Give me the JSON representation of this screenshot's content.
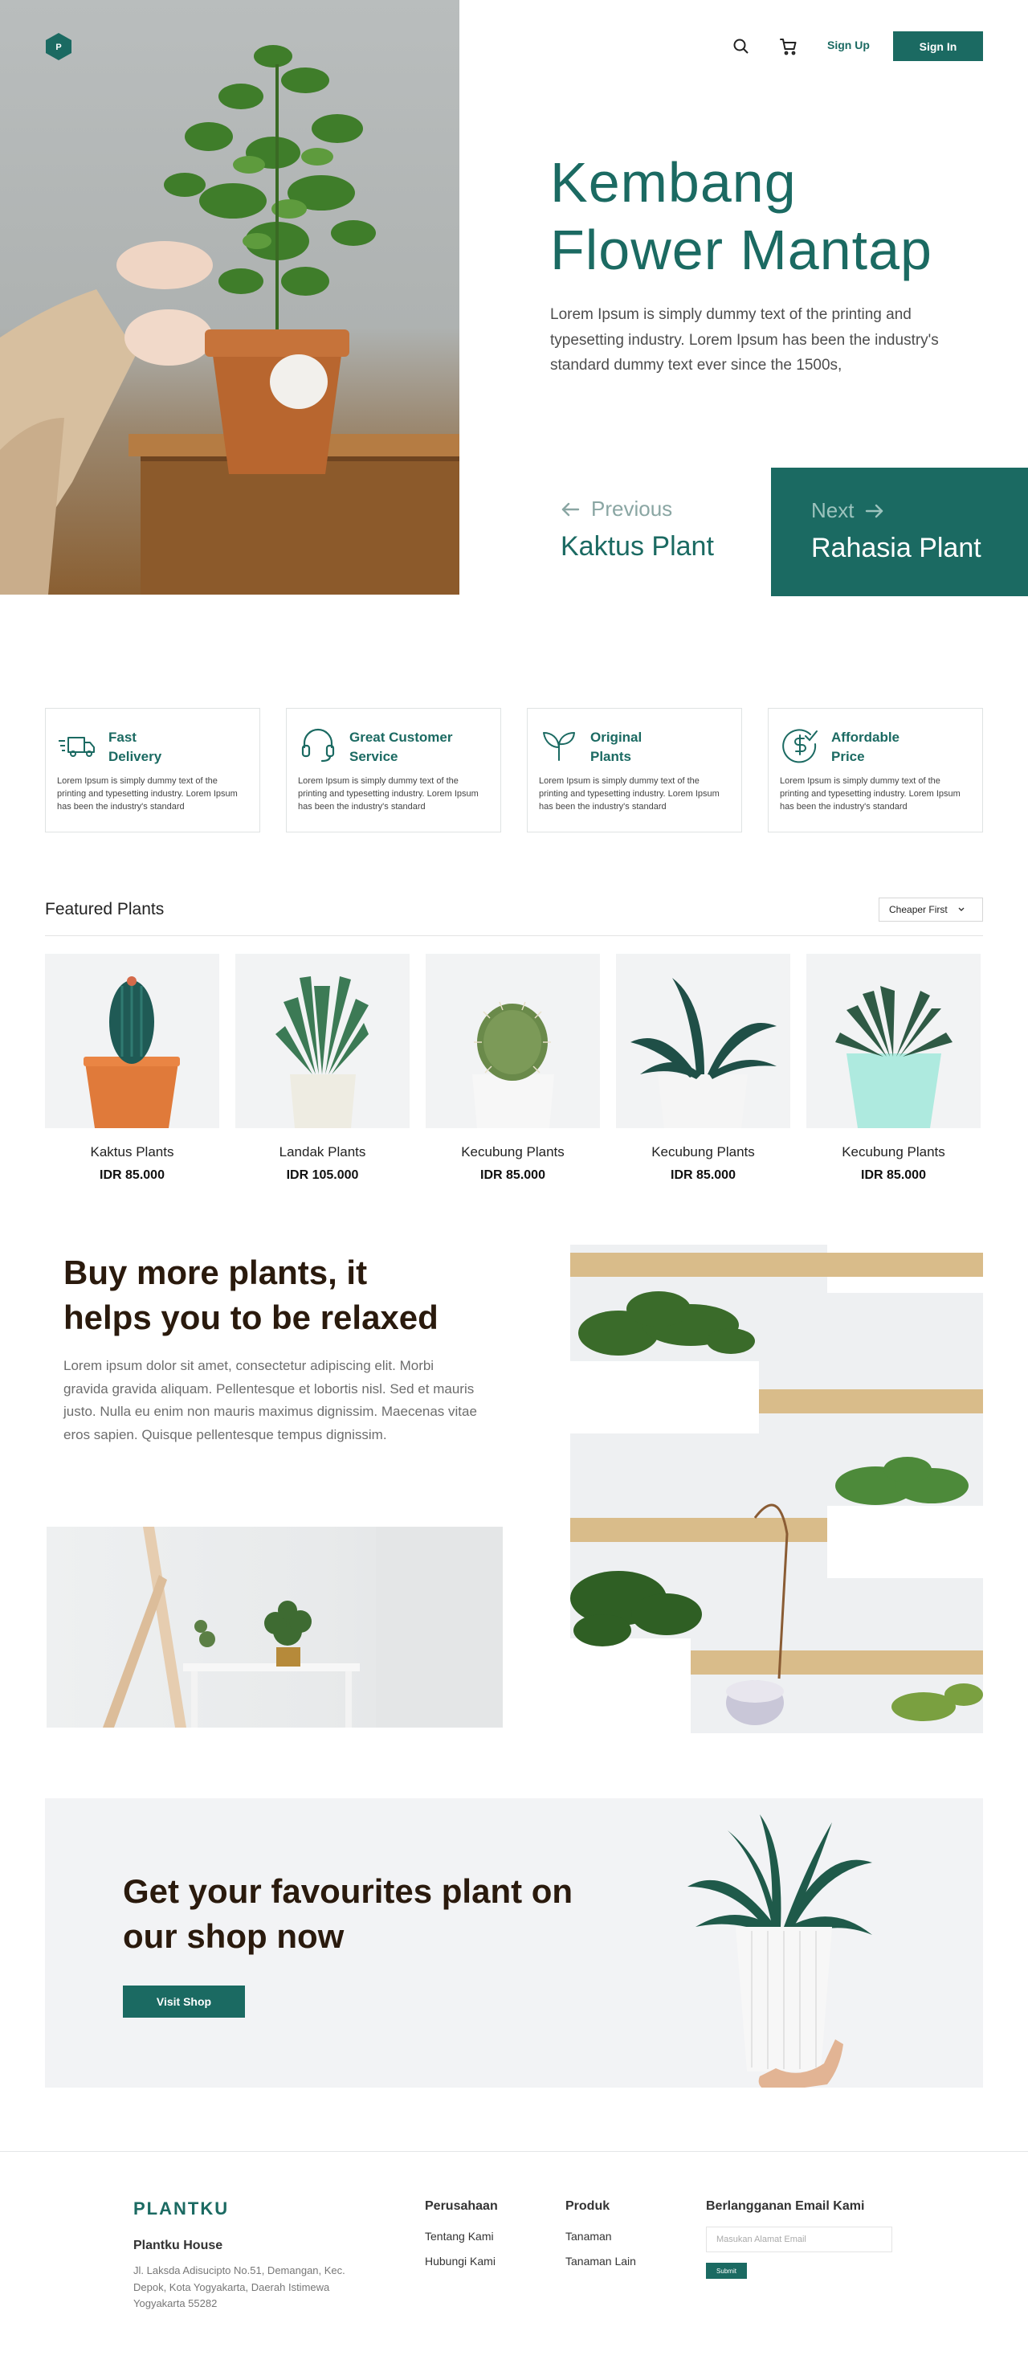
{
  "brand": {
    "logo_letter": "P",
    "accent": "#1b6a62"
  },
  "nav": {
    "signup": "Sign Up",
    "signin": "Sign In"
  },
  "hero": {
    "title_line1": "Kembang",
    "title_line2": "Flower Mantap",
    "description": "Lorem Ipsum is simply dummy text of the printing and typesetting industry. Lorem Ipsum has been the industry's standard dummy text ever since the 1500s,",
    "prev_label": "Previous",
    "prev_name": "Kaktus Plant",
    "next_label": "Next",
    "next_name": "Rahasia Plant"
  },
  "features": [
    {
      "icon": "truck-icon",
      "title_line1": "Fast",
      "title_line2": "Delivery",
      "desc": "Lorem Ipsum is simply dummy text of the printing and typesetting industry. Lorem Ipsum has been the industry's standard"
    },
    {
      "icon": "headset-icon",
      "title_line1": "Great Customer",
      "title_line2": "Service",
      "desc": "Lorem Ipsum is simply dummy text of the printing and typesetting industry. Lorem Ipsum has been the industry's standard"
    },
    {
      "icon": "sprout-icon",
      "title_line1": "Original",
      "title_line2": "Plants",
      "desc": "Lorem Ipsum is simply dummy text of the printing and typesetting industry. Lorem Ipsum has been the industry's standard"
    },
    {
      "icon": "dollar-badge-icon",
      "title_line1": "Affordable",
      "title_line2": "Price",
      "desc": "Lorem Ipsum is simply dummy text of the printing and typesetting industry. Lorem Ipsum has been the industry's standard"
    }
  ],
  "featured": {
    "title": "Featured Plants",
    "sort": "Cheaper First",
    "products": [
      {
        "name": "Kaktus Plants",
        "price": "IDR 85.000"
      },
      {
        "name": "Landak Plants",
        "price": "IDR 105.000"
      },
      {
        "name": "Kecubung Plants",
        "price": "IDR 85.000"
      },
      {
        "name": "Kecubung Plants",
        "price": "IDR 85.000"
      },
      {
        "name": "Kecubung Plants",
        "price": "IDR 85.000"
      }
    ]
  },
  "relax": {
    "title_line1": "Buy more plants, it",
    "title_line2": "helps you to be relaxed",
    "description": "Lorem ipsum dolor sit amet, consectetur adipiscing elit. Morbi gravida gravida aliquam. Pellentesque et lobortis nisl. Sed et mauris justo. Nulla eu enim non mauris maximus dignissim. Maecenas vitae eros sapien. Quisque pellentesque tempus dignissim."
  },
  "cta": {
    "title_line1": "Get your favourites plant on",
    "title_line2": "our shop now",
    "button": "Visit Shop"
  },
  "footer": {
    "brand": "PLANTKU",
    "company": "Plantku House",
    "address": "Jl. Laksda Adisucipto No.51, Demangan, Kec. Depok, Kota Yogyakarta, Daerah Istimewa Yogyakarta 55282",
    "col1_title": "Perusahaan",
    "col1_links": [
      "Tentang Kami",
      "Hubungi Kami"
    ],
    "col2_title": "Produk",
    "col2_links": [
      "Tanaman",
      "Tanaman Lain"
    ],
    "newsletter_title": "Berlangganan Email Kami",
    "email_placeholder": "Masukan Alamat Email",
    "submit": "Submit"
  }
}
